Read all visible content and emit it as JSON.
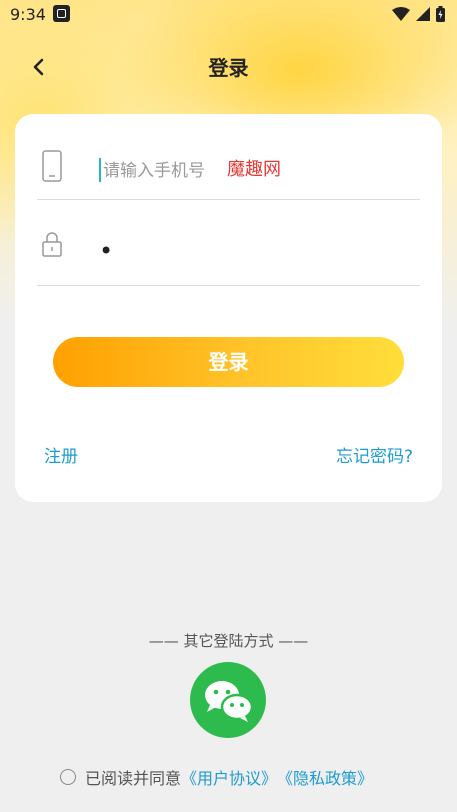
{
  "status_bar": {
    "time": "9:34"
  },
  "header": {
    "title": "登录"
  },
  "form": {
    "phone_placeholder": "请输入手机号",
    "watermark": "魔趣网",
    "password_value": "•",
    "login_label": "登录",
    "register_label": "注册",
    "forgot_label": "忘记密码?"
  },
  "social": {
    "divider_label": "—— 其它登陆方式 ——",
    "wechat_icon": "wechat-icon"
  },
  "agreement": {
    "prefix": "已阅读并同意",
    "user_agreement": "《用户协议》",
    "privacy_policy": "《隐私政策》"
  },
  "colors": {
    "accent": "#ffa000",
    "link": "#1e9bd0",
    "wechat": "#2dbb4e"
  }
}
